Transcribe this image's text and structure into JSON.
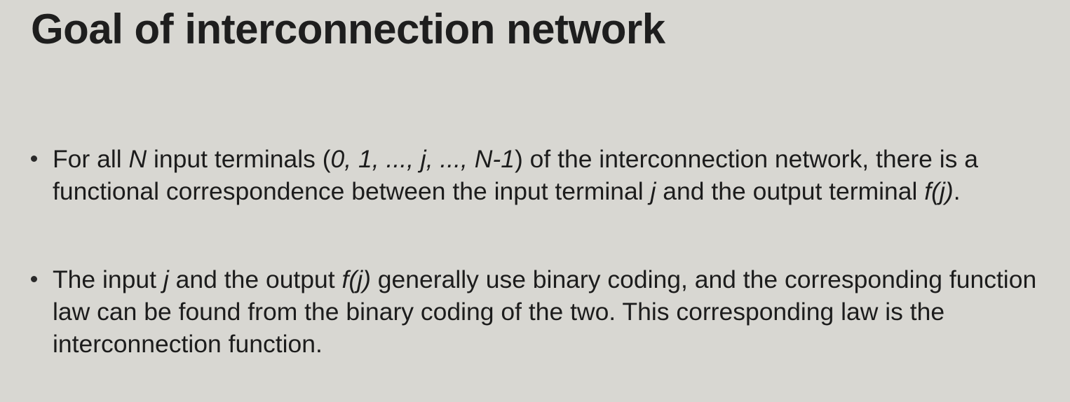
{
  "slide": {
    "title": "Goal of interconnection network",
    "bullet1": {
      "t1": "For all ",
      "n": "N",
      "t2": " input terminals (",
      "range": "0, 1, ..., j, ..., N-1",
      "t3": ") of the interconnection network, there is a functional correspondence between the input terminal ",
      "j": "j",
      "t4": " and the output terminal ",
      "fj": "f(j)",
      "t5": "."
    },
    "bullet2": {
      "t1": "The input ",
      "j": "j",
      "t2": " and the output ",
      "fj": "f(j)",
      "t3": " generally use binary coding, and the corresponding function law can be found from the binary coding of the two. This corresponding law is the interconnection function."
    }
  }
}
